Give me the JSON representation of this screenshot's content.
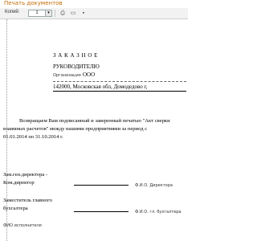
{
  "window": {
    "title": "Печать документов"
  },
  "toolbar": {
    "copies_label": "Копий:",
    "copies_value": "1",
    "icons": [
      "printer-icon",
      "preview-icon",
      "save-icon"
    ]
  },
  "document": {
    "heading": "З А К А З Н О Е",
    "recipient": "РУКОВОДИТЕЛЮ",
    "org_label": "Организация",
    "org_value": "ООО",
    "address": "142000, Московская обл, Домодедово г,",
    "body_line1": "Возвращаем Вам подписанный и заверенный печатью \"Акт сверки",
    "body_line2": "взаимных расчетов\" между нашими предприятиями за период с",
    "body_line3": "01.01.2014 по 31.10.2014 г.",
    "sign1_role_line1": "Зам.ген.директора -",
    "sign1_role_line2": "Ком.директор",
    "sign1_caption": "Ф.И.О. Директора",
    "sign2_role_line1": "Заместитель главного",
    "sign2_role_line2": "бухгалтера",
    "sign2_caption": "Ф.И.О. гл. бухгалтера",
    "executor_label": "ФИО исполнителя"
  },
  "colors": {
    "title": "#c36b00",
    "toolbar_bg": "#f2f2f2"
  }
}
